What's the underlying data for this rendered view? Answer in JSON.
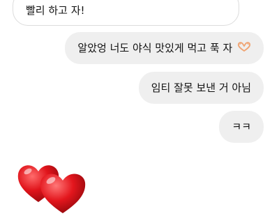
{
  "messages": [
    {
      "direction": "incoming",
      "text": "빨리 하고 자!"
    },
    {
      "direction": "outgoing",
      "text": "알았엉 너도 야식 맛있게 먹고 푹 자",
      "trailing_icon": "heart-hands-icon"
    },
    {
      "direction": "outgoing",
      "text": "임티 잘못 보낸 거 아님"
    },
    {
      "direction": "outgoing",
      "text": "ㅋㅋ"
    }
  ],
  "sticker": {
    "icon": "two-red-hearts-icon"
  },
  "colors": {
    "outgoing_bubble": "#efefef",
    "incoming_border": "#dcdcdc",
    "heart_red": "#e0141b"
  }
}
